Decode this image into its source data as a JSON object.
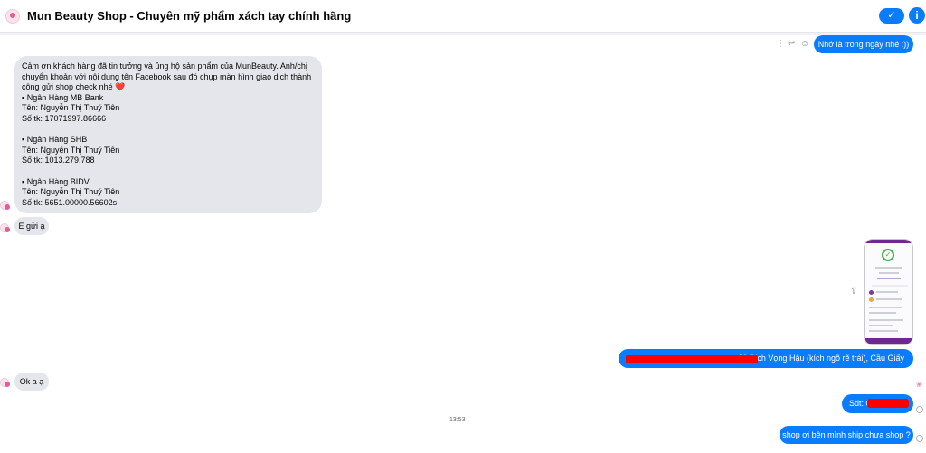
{
  "header": {
    "title": "Mun Beauty Shop - Chuyên mỹ phẩm xách tay chính hãng",
    "check_icon": "✓",
    "info_icon": "i"
  },
  "messages": {
    "out_1": "Nhớ là trong ngày nhé :))",
    "in_bank": "Cảm ơn khách hàng đã tin tưởng và ủng hộ sản phẩm của MunBeauty. Anh/chị\nchuyển khoản với nội dung tên Facebook sau đó chụp màn hình giao dịch thành\ncông gửi shop check nhé ❤️\n  ▪  Ngân Hàng MB Bank\nTên: Nguyễn Thị Thuý Tiên\nSố tk: 17071997.86666\n\n  ▪  Ngân Hàng SHB\nTên: Nguyễn Thị Thuý Tiên\nSố tk: 1013.279.788\n\n  ▪  Ngân Hàng BIDV\nTên: Nguyễn Thị Thuý Tiên\nSố tk: 5651.00000.56602s",
    "in_egui": "E gửi ạ",
    "out_address": "36 Dịch Vọng Hậu (kích ngõ rẽ trái), Cầu Giấy",
    "in_ok": "Ok a ạ",
    "out_sdt": "Sdt: 0",
    "timestamp": "13:53",
    "out_last": "shop ơi bên mình ship chưa shop ?"
  },
  "icons": {
    "more": "⋮",
    "reply": "↩",
    "react": "☺",
    "share": "⇪",
    "heart": "❀"
  },
  "colors": {
    "outgoing": "#0a7cff",
    "incoming": "#e4e6eb",
    "redaction": "#ff0000"
  }
}
